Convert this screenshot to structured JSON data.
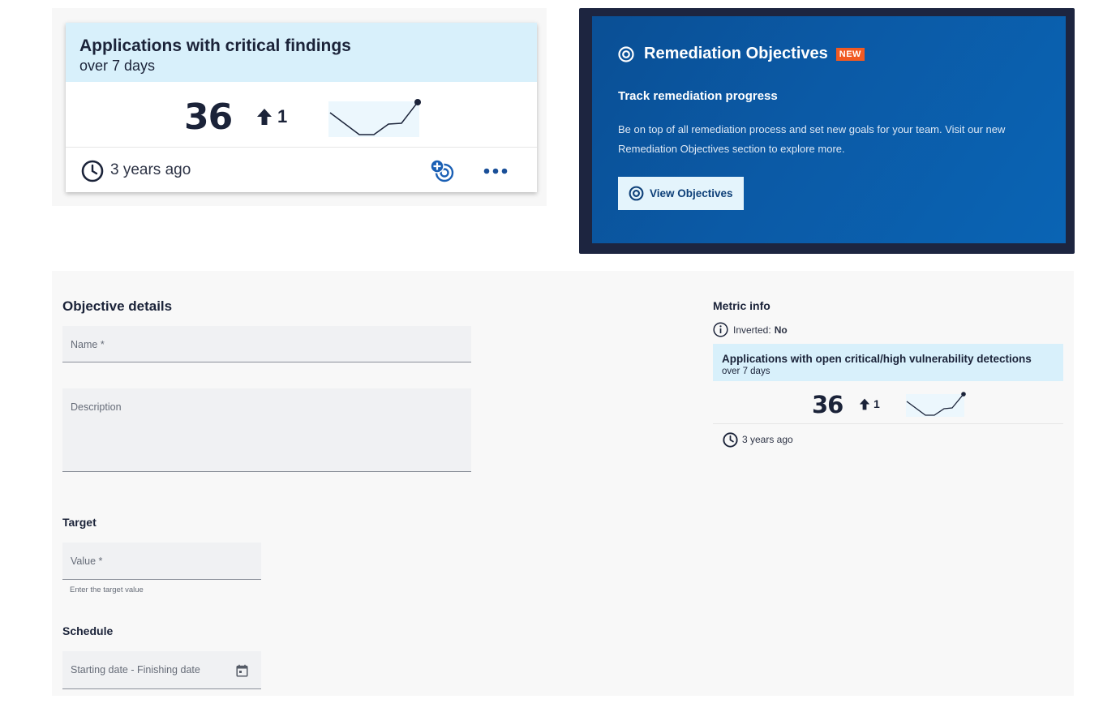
{
  "metric_card": {
    "title": "Applications with critical findings",
    "subtitle": "over 7 days",
    "value": "36",
    "trend_value": "1",
    "trend_direction": "up",
    "updated": "3 years ago",
    "icons": {
      "clock": "clock-icon",
      "add_goal": "add-goal-icon",
      "more": "more-options-icon",
      "trend": "arrow-up-icon"
    }
  },
  "promo": {
    "title": "Remediation Objectives",
    "badge": "NEW",
    "subtitle": "Track remediation progress",
    "text": "Be on top of all remediation process and set new goals for your team. Visit our new Remediation Objectives section to explore more.",
    "button_label": "View Objectives",
    "colors": {
      "badge": "#f15a22",
      "background": "#0b5aa6",
      "frame": "#1d2540"
    }
  },
  "form": {
    "objective_details_title": "Objective details",
    "name_placeholder": "Name *",
    "description_placeholder": "Description",
    "target_title": "Target",
    "value_placeholder": "Value *",
    "value_helper": "Enter the target value",
    "schedule_title": "Schedule",
    "date_placeholder": "Starting date - Finishing date"
  },
  "metric_info": {
    "title": "Metric info",
    "inverted_label": "Inverted:",
    "inverted_value": "No",
    "card": {
      "title": "Applications with open critical/high vulnerability detections",
      "subtitle": "over 7 days",
      "value": "36",
      "trend_value": "1",
      "updated": "3 years ago"
    }
  },
  "colors": {
    "accent": "#1a5fb4",
    "card_header": "#d8f0fb",
    "text": "#1b2339"
  }
}
